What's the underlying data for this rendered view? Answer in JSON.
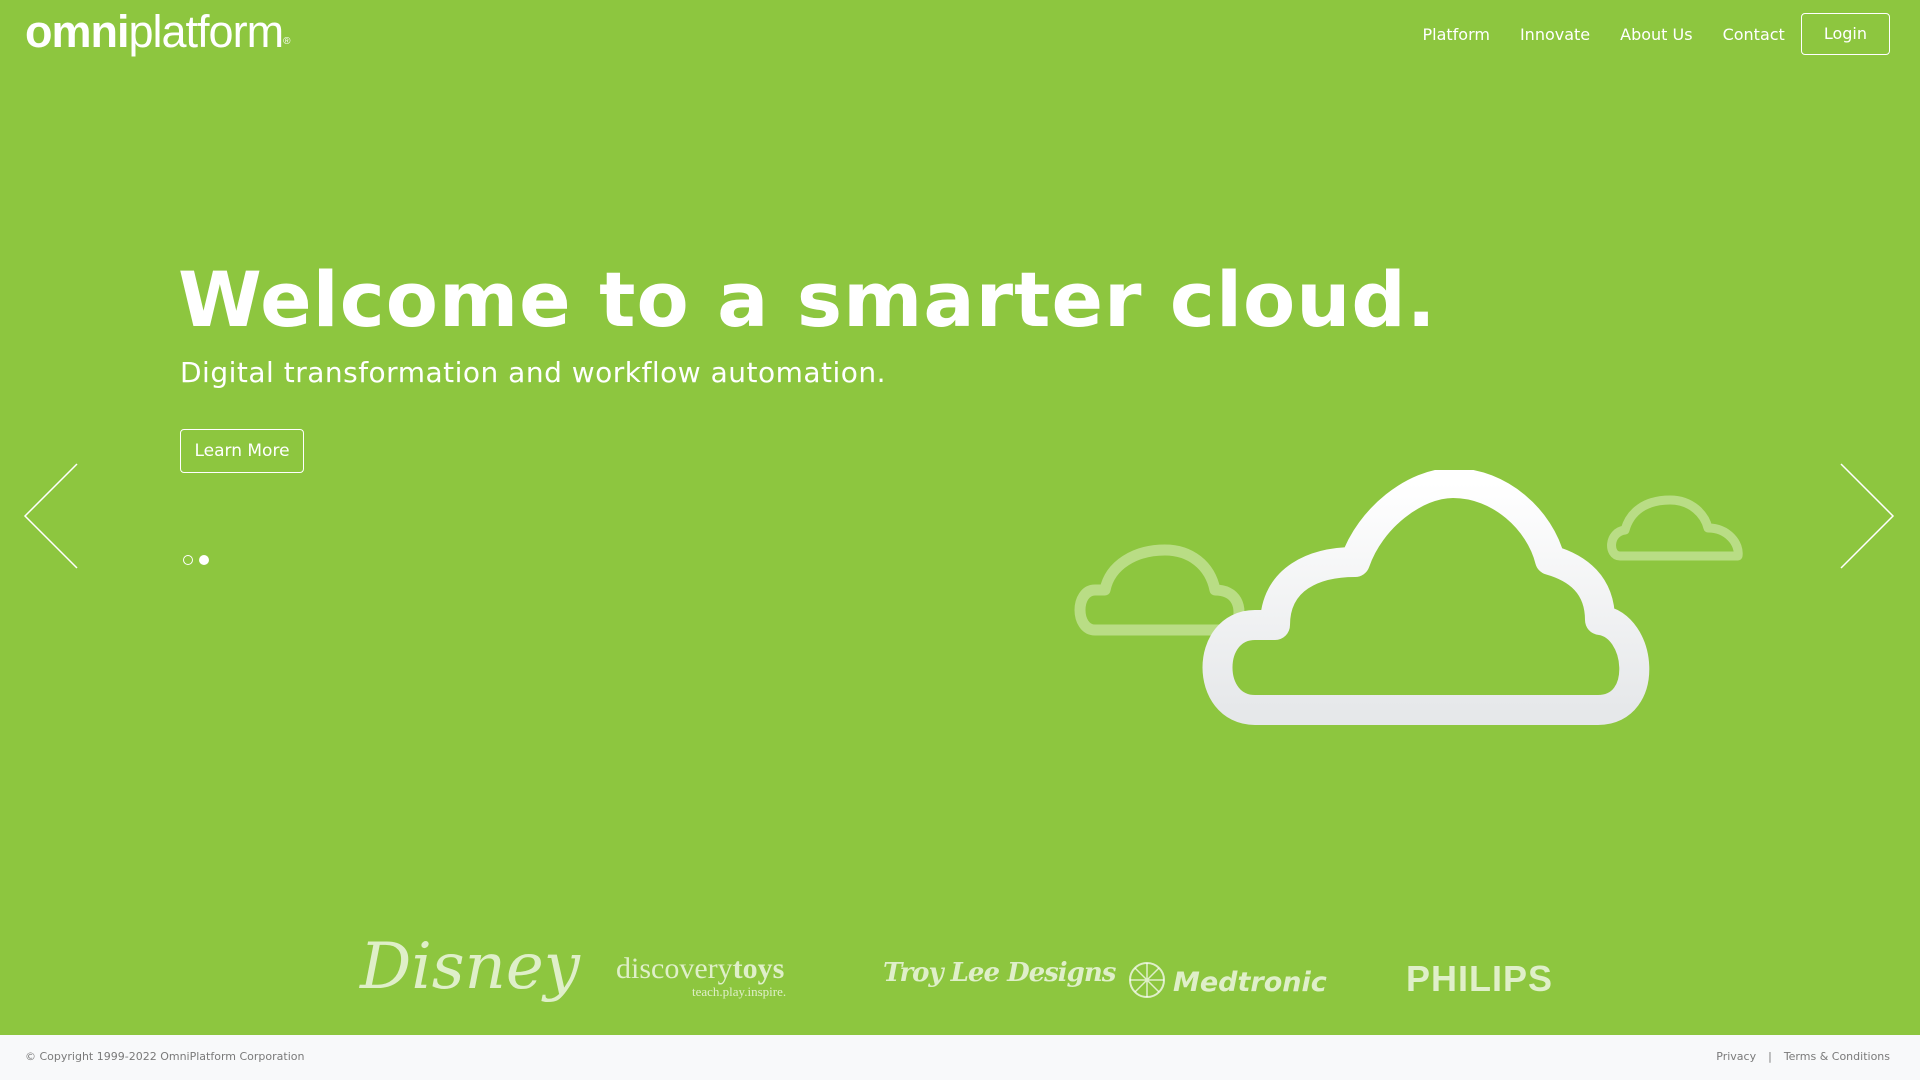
{
  "header": {
    "logo_bold": "omni",
    "logo_light": "platform",
    "logo_mark": "®",
    "nav": [
      "Platform",
      "Innovate",
      "About Us",
      "Contact"
    ],
    "login_label": "Login"
  },
  "hero": {
    "title": "Welcome to a smarter cloud.",
    "subtitle": "Digital transformation and workflow automation.",
    "cta_label": "Learn More",
    "active_slide": 2,
    "slide_count": 2
  },
  "partners": {
    "disney": "Disney",
    "discovery_main": "discovery",
    "discovery_bold": "toys",
    "discovery_tag": "teach.play.inspire.",
    "troylee": "Troy Lee Designs",
    "medtronic": "Medtronic",
    "philips": "PHILIPS"
  },
  "footer": {
    "copyright": "© Copyright 1999-2022 OmniPlatform Corporation",
    "privacy": "Privacy",
    "separator": "|",
    "terms": "Terms & Conditions"
  },
  "colors": {
    "background": "#8dc63f",
    "footer_bg": "#f8f9fa",
    "footer_text": "#7a7a7a"
  },
  "icons": [
    "chevron-left-icon",
    "chevron-right-icon",
    "cloud-large-icon",
    "cloud-small-icon",
    "medtronic-emblem-icon"
  ]
}
